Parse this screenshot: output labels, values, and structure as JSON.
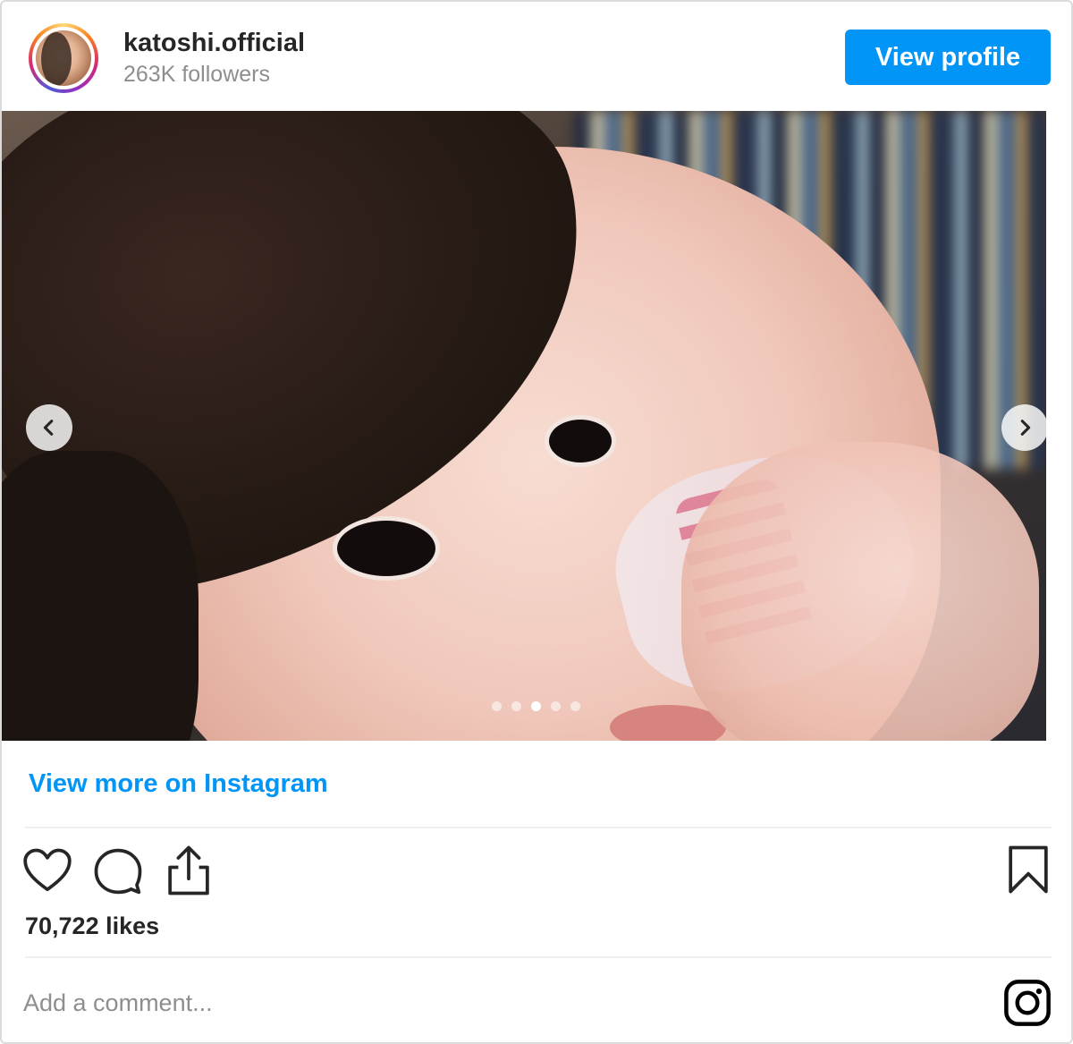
{
  "header": {
    "username": "katoshi.official",
    "followers": "263K followers",
    "view_profile_label": "View profile",
    "avatar_icon": "profile-avatar"
  },
  "media": {
    "carousel": {
      "total_slides": 5,
      "active_slide": 3
    },
    "prev_icon": "chevron-left-icon",
    "next_icon": "chevron-right-icon"
  },
  "links": {
    "view_more": "View more on Instagram"
  },
  "actions": {
    "like_icon": "heart-icon",
    "comment_icon": "comment-icon",
    "share_icon": "share-icon",
    "save_icon": "bookmark-icon",
    "likes_text": "70,722 likes"
  },
  "comment": {
    "placeholder": "Add a comment...",
    "brand_icon": "instagram-icon"
  },
  "colors": {
    "accent": "#0095f6",
    "text": "#262626",
    "muted": "#8e8e8e",
    "border": "#dbdbdb"
  }
}
